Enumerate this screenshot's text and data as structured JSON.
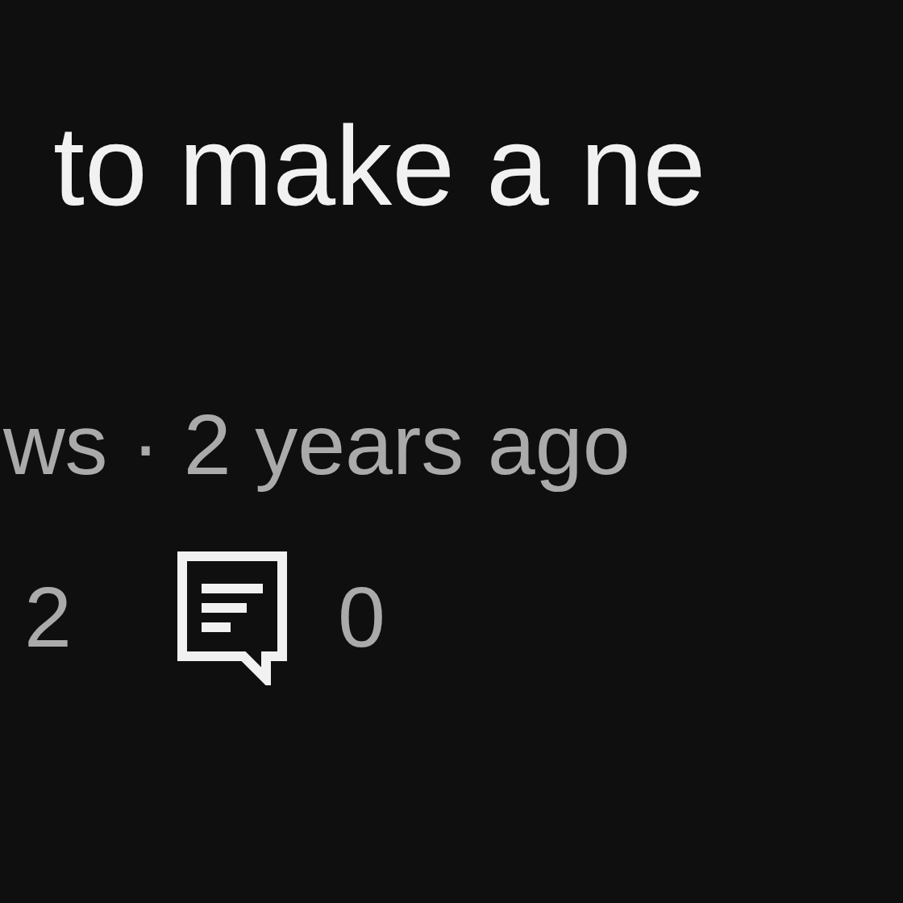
{
  "title": "to make a ne",
  "meta": "ws · 2 years ago",
  "stats": {
    "left_count": "2",
    "comment_count": "0"
  }
}
